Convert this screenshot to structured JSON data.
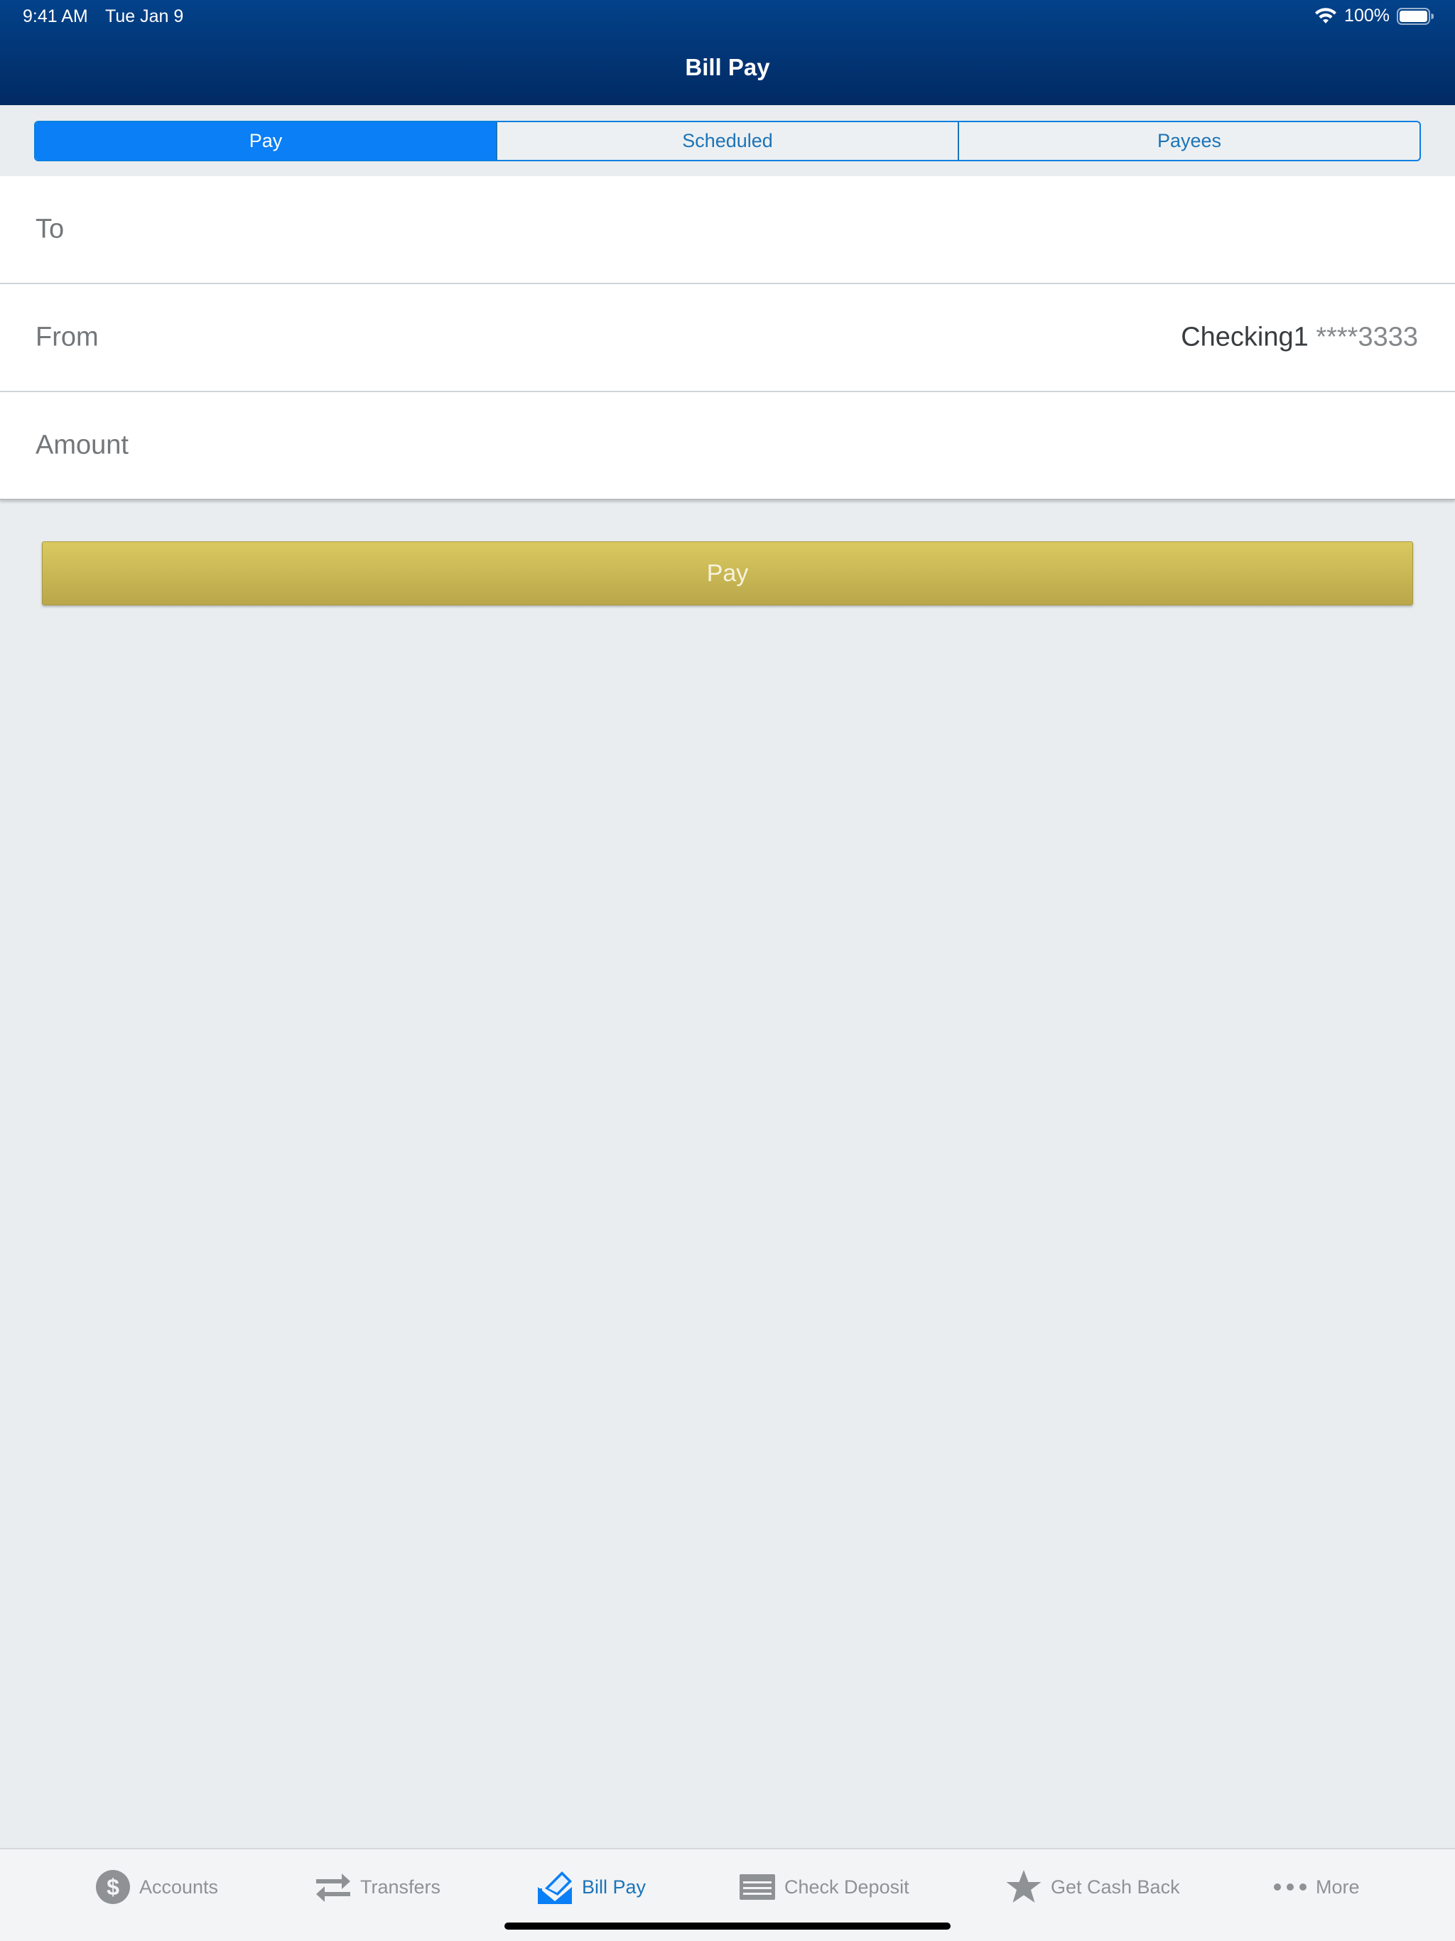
{
  "status_bar": {
    "time": "9:41 AM",
    "date": "Tue Jan 9",
    "battery": "100%"
  },
  "nav": {
    "title": "Bill Pay"
  },
  "segments": [
    {
      "label": "Pay",
      "active": true
    },
    {
      "label": "Scheduled",
      "active": false
    },
    {
      "label": "Payees",
      "active": false
    }
  ],
  "form": {
    "to_label": "To",
    "from_label": "From",
    "from_account_name": "Checking1",
    "from_account_mask": "****3333",
    "amount_label": "Amount"
  },
  "pay_button": {
    "label": "Pay"
  },
  "tabs": [
    {
      "label": "Accounts",
      "icon": "dollar-icon",
      "active": false
    },
    {
      "label": "Transfers",
      "icon": "transfer-arrows-icon",
      "active": false
    },
    {
      "label": "Bill Pay",
      "icon": "bill-pay-icon",
      "active": true
    },
    {
      "label": "Check Deposit",
      "icon": "check-icon",
      "active": false
    },
    {
      "label": "Get Cash Back",
      "icon": "star-icon",
      "active": false
    },
    {
      "label": "More",
      "icon": "more-dots-icon",
      "active": false
    }
  ],
  "colors": {
    "header": "#03428a",
    "accent": "#0a7ff6",
    "pay_button": "#d4c35c",
    "background": "#e9edef"
  }
}
